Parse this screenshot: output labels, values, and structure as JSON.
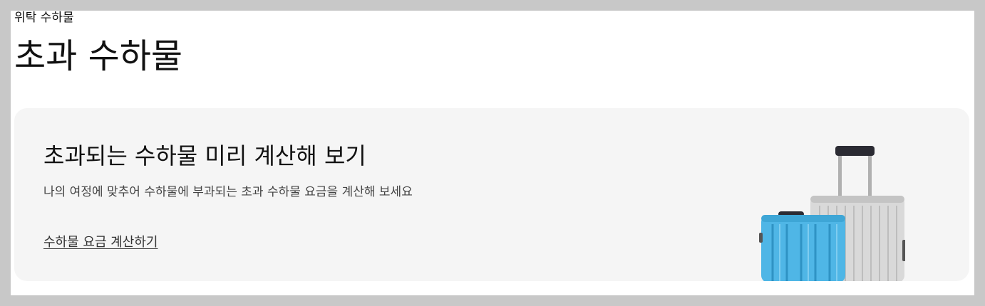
{
  "breadcrumb": "위탁 수하물",
  "page_title": "초과 수하물",
  "calculator_card": {
    "title": "초과되는 수하물 미리 계산해 보기",
    "description": "나의 여정에 맞추어 수하물에 부과되는 초과 수하물 요금을 계산해 보세요",
    "link_label": "수하물 요금 계산하기",
    "image": "luggage-illustration"
  },
  "colors": {
    "background": "#c8c8c8",
    "page": "#ffffff",
    "card": "#f5f5f5",
    "suitcase_blue": "#4fb6e6",
    "suitcase_silver": "#d9d9d9"
  }
}
